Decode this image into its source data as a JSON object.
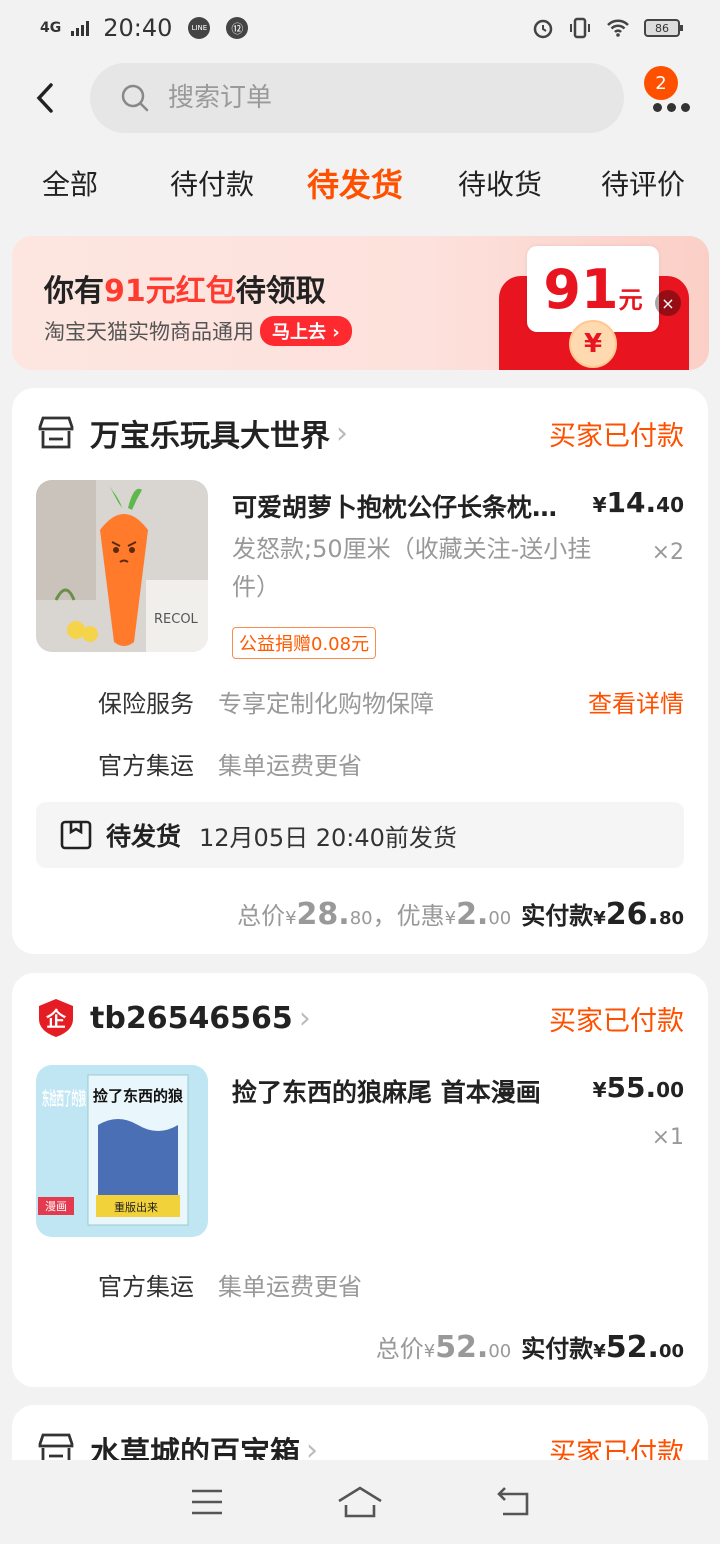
{
  "status_bar": {
    "network": "4G",
    "time": "20:40",
    "icon1": "LINE",
    "icon2": "⑫",
    "battery": "86"
  },
  "search": {
    "placeholder": "搜索订单"
  },
  "header": {
    "more_badge": "2"
  },
  "tabs": [
    {
      "label": "全部"
    },
    {
      "label": "待付款"
    },
    {
      "label": "待发货"
    },
    {
      "label": "待收货"
    },
    {
      "label": "待评价"
    }
  ],
  "banner": {
    "title_pre": "你有",
    "title_highlight": "91元红包",
    "title_post": "待领取",
    "subtitle": "淘宝天猫实物商品通用",
    "button": "马上去",
    "amount": "91",
    "unit": "元",
    "coin": "¥"
  },
  "orders": [
    {
      "shop_name": "万宝乐玩具大世界",
      "status": "买家已付款",
      "product_title": "可爱胡萝卜抱枕公仔长条枕头毛绒玩具",
      "price_symbol": "¥",
      "price_int": "14.",
      "price_dec": "40",
      "quantity": "×2",
      "sku": "发怒款;50厘米（收藏关注-送小挂件）",
      "tag": "公益捐赠0.08元",
      "services": [
        {
          "label": "保险服务",
          "desc": "专享定制化购物保障",
          "link": "查看详情"
        },
        {
          "label": "官方集运",
          "desc": "集单运费更省"
        }
      ],
      "ship_status": "待发货",
      "ship_time": "12月05日 20:40前发货",
      "total_label": "总价",
      "total_int": "28.",
      "total_dec": "80",
      "sep": "，",
      "discount_label": "优惠",
      "discount_int": "2.",
      "discount_dec": "00",
      "paid_label": "实付款",
      "paid_int": "26.",
      "paid_dec": "80",
      "thumb_text": "RECOL"
    },
    {
      "shop_name": "tb26546565",
      "status": "买家已付款",
      "product_title": "捡了东西的狼麻尾 首本漫画",
      "price_symbol": "¥",
      "price_int": "55.",
      "price_dec": "00",
      "quantity": "×1",
      "services": [
        {
          "label": "官方集运",
          "desc": "集单运费更省"
        }
      ],
      "total_label": "总价",
      "total_int": "52.",
      "total_dec": "00",
      "paid_label": "实付款",
      "paid_int": "52.",
      "paid_dec": "00",
      "thumb_title": "捡了东西的狼",
      "thumb_side": "东捡西了的狼",
      "thumb_tag": "漫画",
      "thumb_badge": "重版出来"
    },
    {
      "shop_name": "水草城的百宝箱",
      "status": "买家已付款"
    }
  ],
  "icons": {
    "back": "chevron-left-icon",
    "search": "search-icon",
    "more": "more-dots-icon",
    "shop": "shop-icon",
    "enterprise": "enterprise-shield-icon",
    "ship": "package-icon",
    "nav": [
      "menu-icon",
      "home-icon",
      "back-icon"
    ]
  },
  "colors": {
    "accent": "#ff5000",
    "red": "#e8141f",
    "background": "#f2f2f2"
  }
}
